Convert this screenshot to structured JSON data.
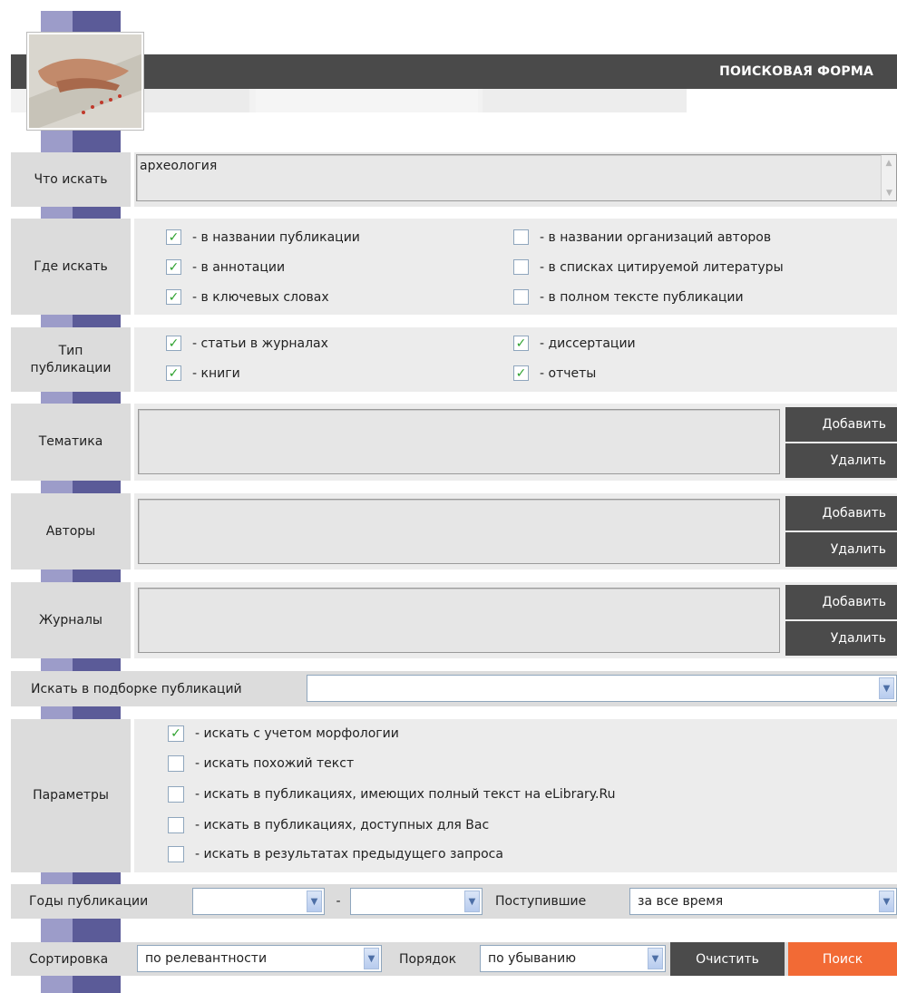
{
  "header": {
    "title": "ПОИСКОВАЯ ФОРМА"
  },
  "query": {
    "label": "Что искать",
    "value": "археология"
  },
  "where": {
    "label": "Где искать",
    "options": [
      {
        "label": "- в названии публикации",
        "checked": true
      },
      {
        "label": "- в аннотации",
        "checked": true
      },
      {
        "label": "- в ключевых словах",
        "checked": true
      },
      {
        "label": "- в названии организаций авторов",
        "checked": false
      },
      {
        "label": "- в списках цитируемой литературы",
        "checked": false
      },
      {
        "label": "- в полном тексте публикации",
        "checked": false
      }
    ]
  },
  "pubtype": {
    "label": "Тип публикации",
    "options": [
      {
        "label": "- статьи в журналах",
        "checked": true
      },
      {
        "label": "- книги",
        "checked": true
      },
      {
        "label": "- диссертации",
        "checked": true
      },
      {
        "label": "- отчеты",
        "checked": true
      }
    ]
  },
  "topics": {
    "label": "Тематика",
    "add": "Добавить",
    "remove": "Удалить"
  },
  "authors": {
    "label": "Авторы",
    "add": "Добавить",
    "remove": "Удалить"
  },
  "journals": {
    "label": "Журналы",
    "add": "Добавить",
    "remove": "Удалить"
  },
  "collection": {
    "label": "Искать в подборке публикаций",
    "value": ""
  },
  "params": {
    "label": "Параметры",
    "options": [
      {
        "label": "- искать с учетом морфологии",
        "checked": true
      },
      {
        "label": "- искать похожий текст",
        "checked": false
      },
      {
        "label": "- искать в публикациях, имеющих полный текст на eLibrary.Ru",
        "checked": false
      },
      {
        "label": "- искать в публикациях, доступных для Вас",
        "checked": false
      },
      {
        "label": "- искать в результатах предыдущего запроса",
        "checked": false
      }
    ]
  },
  "years": {
    "label": "Годы публикации",
    "from": "",
    "dash": "-",
    "to": "",
    "received_label": "Поступившие",
    "received_value": "за все время"
  },
  "sorting": {
    "label": "Сортировка",
    "value": "по релевантности",
    "order_label": "Порядок",
    "order_value": "по убыванию",
    "clear": "Очистить",
    "search": "Поиск"
  },
  "colors": {
    "accent": "#f26a35",
    "dark": "#4b4b4b",
    "check": "#2fa22f"
  }
}
